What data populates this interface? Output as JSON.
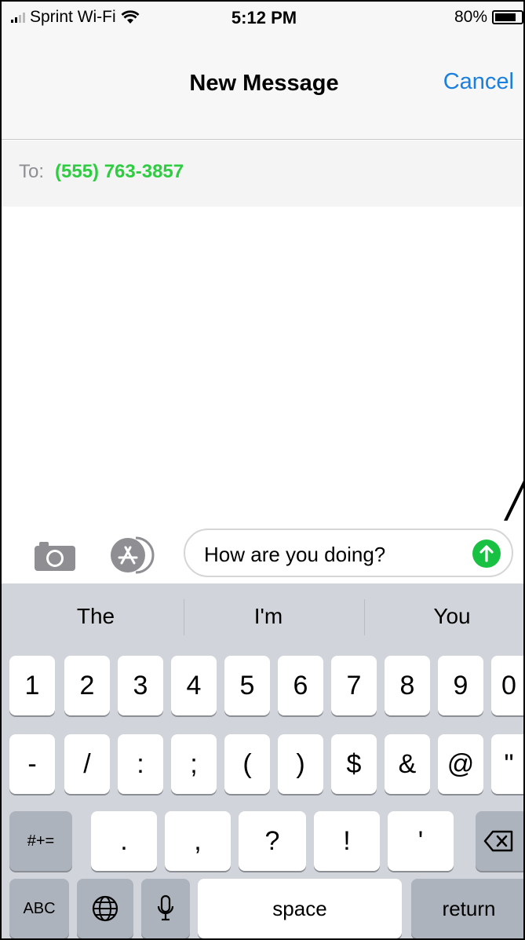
{
  "status_bar": {
    "carrier": "Sprint Wi-Fi",
    "time": "5:12 PM",
    "battery": "80%",
    "battery_level": 0.8
  },
  "nav": {
    "title": "New Message",
    "cancel_label": "Cancel"
  },
  "to_row": {
    "label": "To:",
    "recipient": "(555) 763-3857"
  },
  "compose": {
    "message_text": "How are you doing?"
  },
  "keyboard": {
    "suggestions": [
      "The",
      "I'm",
      "You"
    ],
    "number_row": [
      "1",
      "2",
      "3",
      "4",
      "5",
      "6",
      "7",
      "8",
      "9",
      "0"
    ],
    "symbol_row": [
      "-",
      "/",
      ":",
      ";",
      "(",
      ")",
      "$",
      "&",
      "@",
      "\""
    ],
    "punct_row": {
      "shift_label": "#+=",
      "keys": [
        ".",
        ",",
        "?",
        "!",
        "'"
      ]
    },
    "bottom_row": {
      "abc": "ABC",
      "space": "space",
      "return": "return"
    }
  },
  "colors": {
    "accent_blue": "#1b7fe0",
    "recipient_green": "#2ecc40",
    "send_green": "#19c142"
  },
  "icons": {
    "wifi": "wifi-icon",
    "camera": "camera-icon",
    "appstore": "app-store-icon",
    "send": "send-arrow-icon",
    "globe": "globe-icon",
    "mic": "microphone-icon",
    "backspace": "backspace-icon"
  }
}
